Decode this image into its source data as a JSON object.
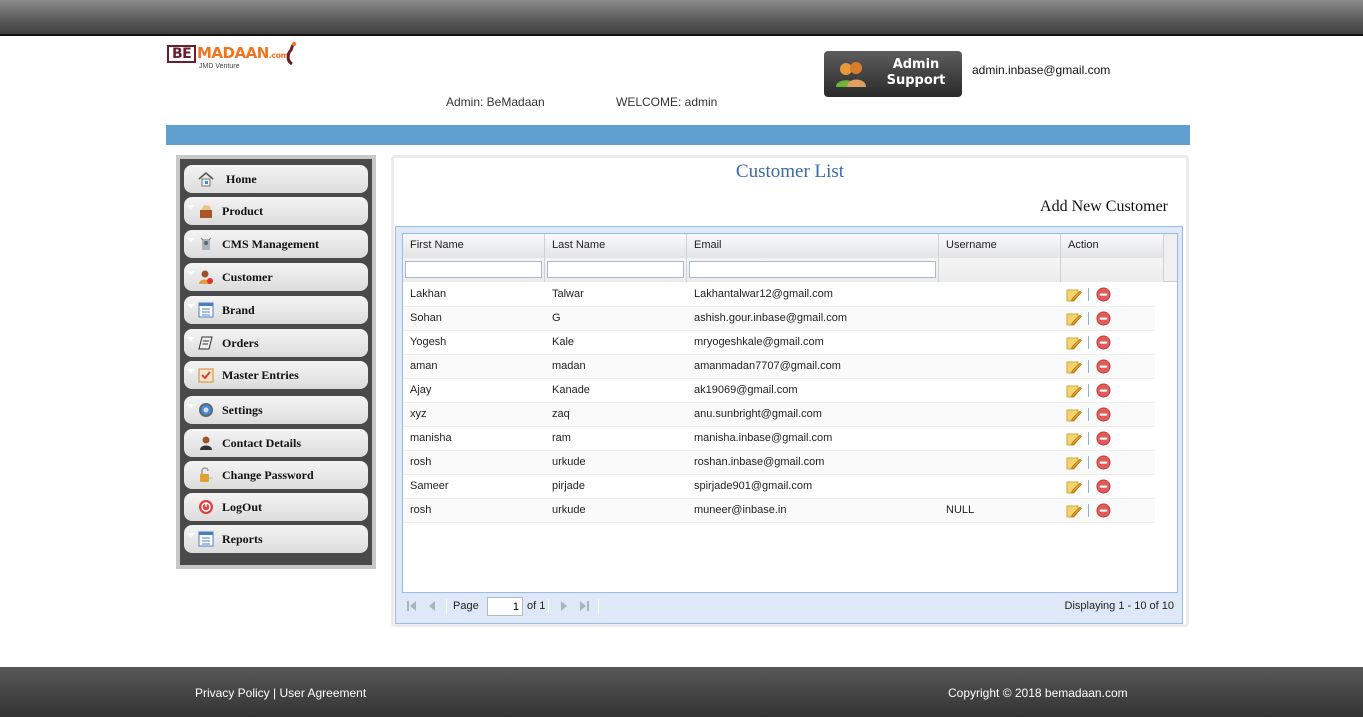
{
  "header": {
    "logo": {
      "brand_prefix": "BE",
      "brand_name": "MADAAN",
      "brand_suffix": ".com",
      "tagline": "JMD Venture"
    },
    "support_button_line1": "Admin",
    "support_button_line2": "Support",
    "admin_email": "admin.inbase@gmail.com",
    "admin_label": "Admin: BeMadaan",
    "welcome_label": "WELCOME: admin",
    "accent_color": "#5fa0d0"
  },
  "sidebar": {
    "items": [
      {
        "label": "Home",
        "icon": "home-icon",
        "expandable": false
      },
      {
        "label": "Product",
        "icon": "box-icon",
        "expandable": true
      },
      {
        "label": "CMS Management",
        "icon": "cms-icon",
        "expandable": true
      },
      {
        "label": "Customer",
        "icon": "customer-icon",
        "expandable": true
      },
      {
        "label": "Brand",
        "icon": "list-icon",
        "expandable": true
      },
      {
        "label": "Orders",
        "icon": "orders-icon",
        "expandable": true
      },
      {
        "label": "Master Entries",
        "icon": "checklist-icon",
        "expandable": true
      },
      {
        "label": "Settings",
        "icon": "gear-icon",
        "expandable": true
      },
      {
        "label": "Contact Details",
        "icon": "contact-icon",
        "expandable": false
      },
      {
        "label": "Change Password",
        "icon": "lock-icon",
        "expandable": false
      },
      {
        "label": "LogOut",
        "icon": "power-icon",
        "expandable": false
      },
      {
        "label": "Reports",
        "icon": "report-icon",
        "expandable": true
      }
    ]
  },
  "main": {
    "title": "Customer List",
    "add_new_label": "Add New Customer",
    "grid": {
      "columns": [
        "First Name",
        "Last Name",
        "Email",
        "Username",
        "Action"
      ],
      "filters": {
        "first_name": "",
        "last_name": "",
        "email": ""
      },
      "rows": [
        {
          "first": "Lakhan",
          "last": "Talwar",
          "email": "Lakhantalwar12@gmail.com",
          "username": ""
        },
        {
          "first": "Sohan",
          "last": "G",
          "email": "ashish.gour.inbase@gmail.com",
          "username": ""
        },
        {
          "first": "Yogesh",
          "last": "Kale",
          "email": "mryogeshkale@gmail.com",
          "username": ""
        },
        {
          "first": "aman",
          "last": "madan",
          "email": "amanmadan7707@gmail.com",
          "username": ""
        },
        {
          "first": "Ajay",
          "last": "Kanade",
          "email": "ak19069@gmail.com",
          "username": ""
        },
        {
          "first": "xyz",
          "last": "zaq",
          "email": "anu.sunbright@gmail.com",
          "username": ""
        },
        {
          "first": "manisha",
          "last": "ram",
          "email": "manisha.inbase@gmail.com",
          "username": ""
        },
        {
          "first": "rosh",
          "last": "urkude",
          "email": "roshan.inbase@gmail.com",
          "username": ""
        },
        {
          "first": "Sameer",
          "last": "pirjade",
          "email": "spirjade901@gmail.com",
          "username": ""
        },
        {
          "first": "rosh",
          "last": "urkude",
          "email": "muneer@inbase.in",
          "username": "NULL"
        }
      ]
    },
    "pager": {
      "page_label": "Page",
      "current_page": "1",
      "of_label": "of 1",
      "displaying": "Displaying 1 - 10 of 10"
    }
  },
  "footer": {
    "privacy": "Privacy Policy",
    "separator": " | ",
    "agreement": "User Agreement",
    "copyright": "Copyright © 2018 bemadaan.com"
  }
}
